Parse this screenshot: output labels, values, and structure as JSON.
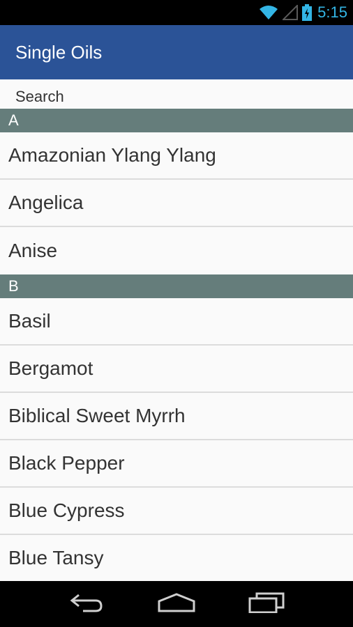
{
  "status_bar": {
    "time": "5:15",
    "icons": [
      "wifi-icon",
      "signal-icon",
      "battery-charging-icon"
    ],
    "accent": "#33b5e5"
  },
  "action_bar": {
    "title": "Single Oils",
    "color": "#2b5397"
  },
  "search": {
    "placeholder": "Search"
  },
  "sections": [
    {
      "letter": "A",
      "items": [
        "Amazonian Ylang Ylang",
        "Angelica",
        "Anise"
      ]
    },
    {
      "letter": "B",
      "items": [
        "Basil",
        "Bergamot",
        "Biblical Sweet Myrrh",
        "Black Pepper",
        "Blue Cypress",
        "Blue Tansy"
      ]
    }
  ],
  "section_header_color": "#657d7b",
  "nav_bar": {
    "buttons": [
      "back-icon",
      "home-icon",
      "recent-apps-icon"
    ]
  }
}
